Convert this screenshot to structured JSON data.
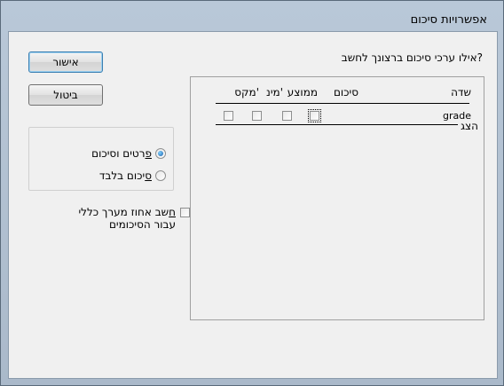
{
  "window": {
    "title": "אפשרויות סיכום"
  },
  "buttons": {
    "ok_label": "אישור",
    "cancel_label": "ביטול"
  },
  "question": "אילו ערכי סיכום ברצונך לחשב?",
  "grid": {
    "headers": {
      "field": "שדה",
      "sum": "סיכום",
      "avg": "ממוצע",
      "min": "מינ'",
      "max": "מקס'"
    },
    "rows": [
      {
        "field": "grade",
        "sum": false,
        "avg": false,
        "min": false,
        "max": false
      }
    ]
  },
  "show_group": {
    "caption": "הצג",
    "options": [
      {
        "accel": "פ",
        "rest": "רטים וסיכום",
        "selected": true
      },
      {
        "accel": "ס",
        "rest": "יכום בלבד",
        "selected": false
      }
    ]
  },
  "percent_option": {
    "accel": "ח",
    "line1_rest": "שב אחוז מערך כללי",
    "line2": "עבור הסיכומים",
    "checked": false
  }
}
